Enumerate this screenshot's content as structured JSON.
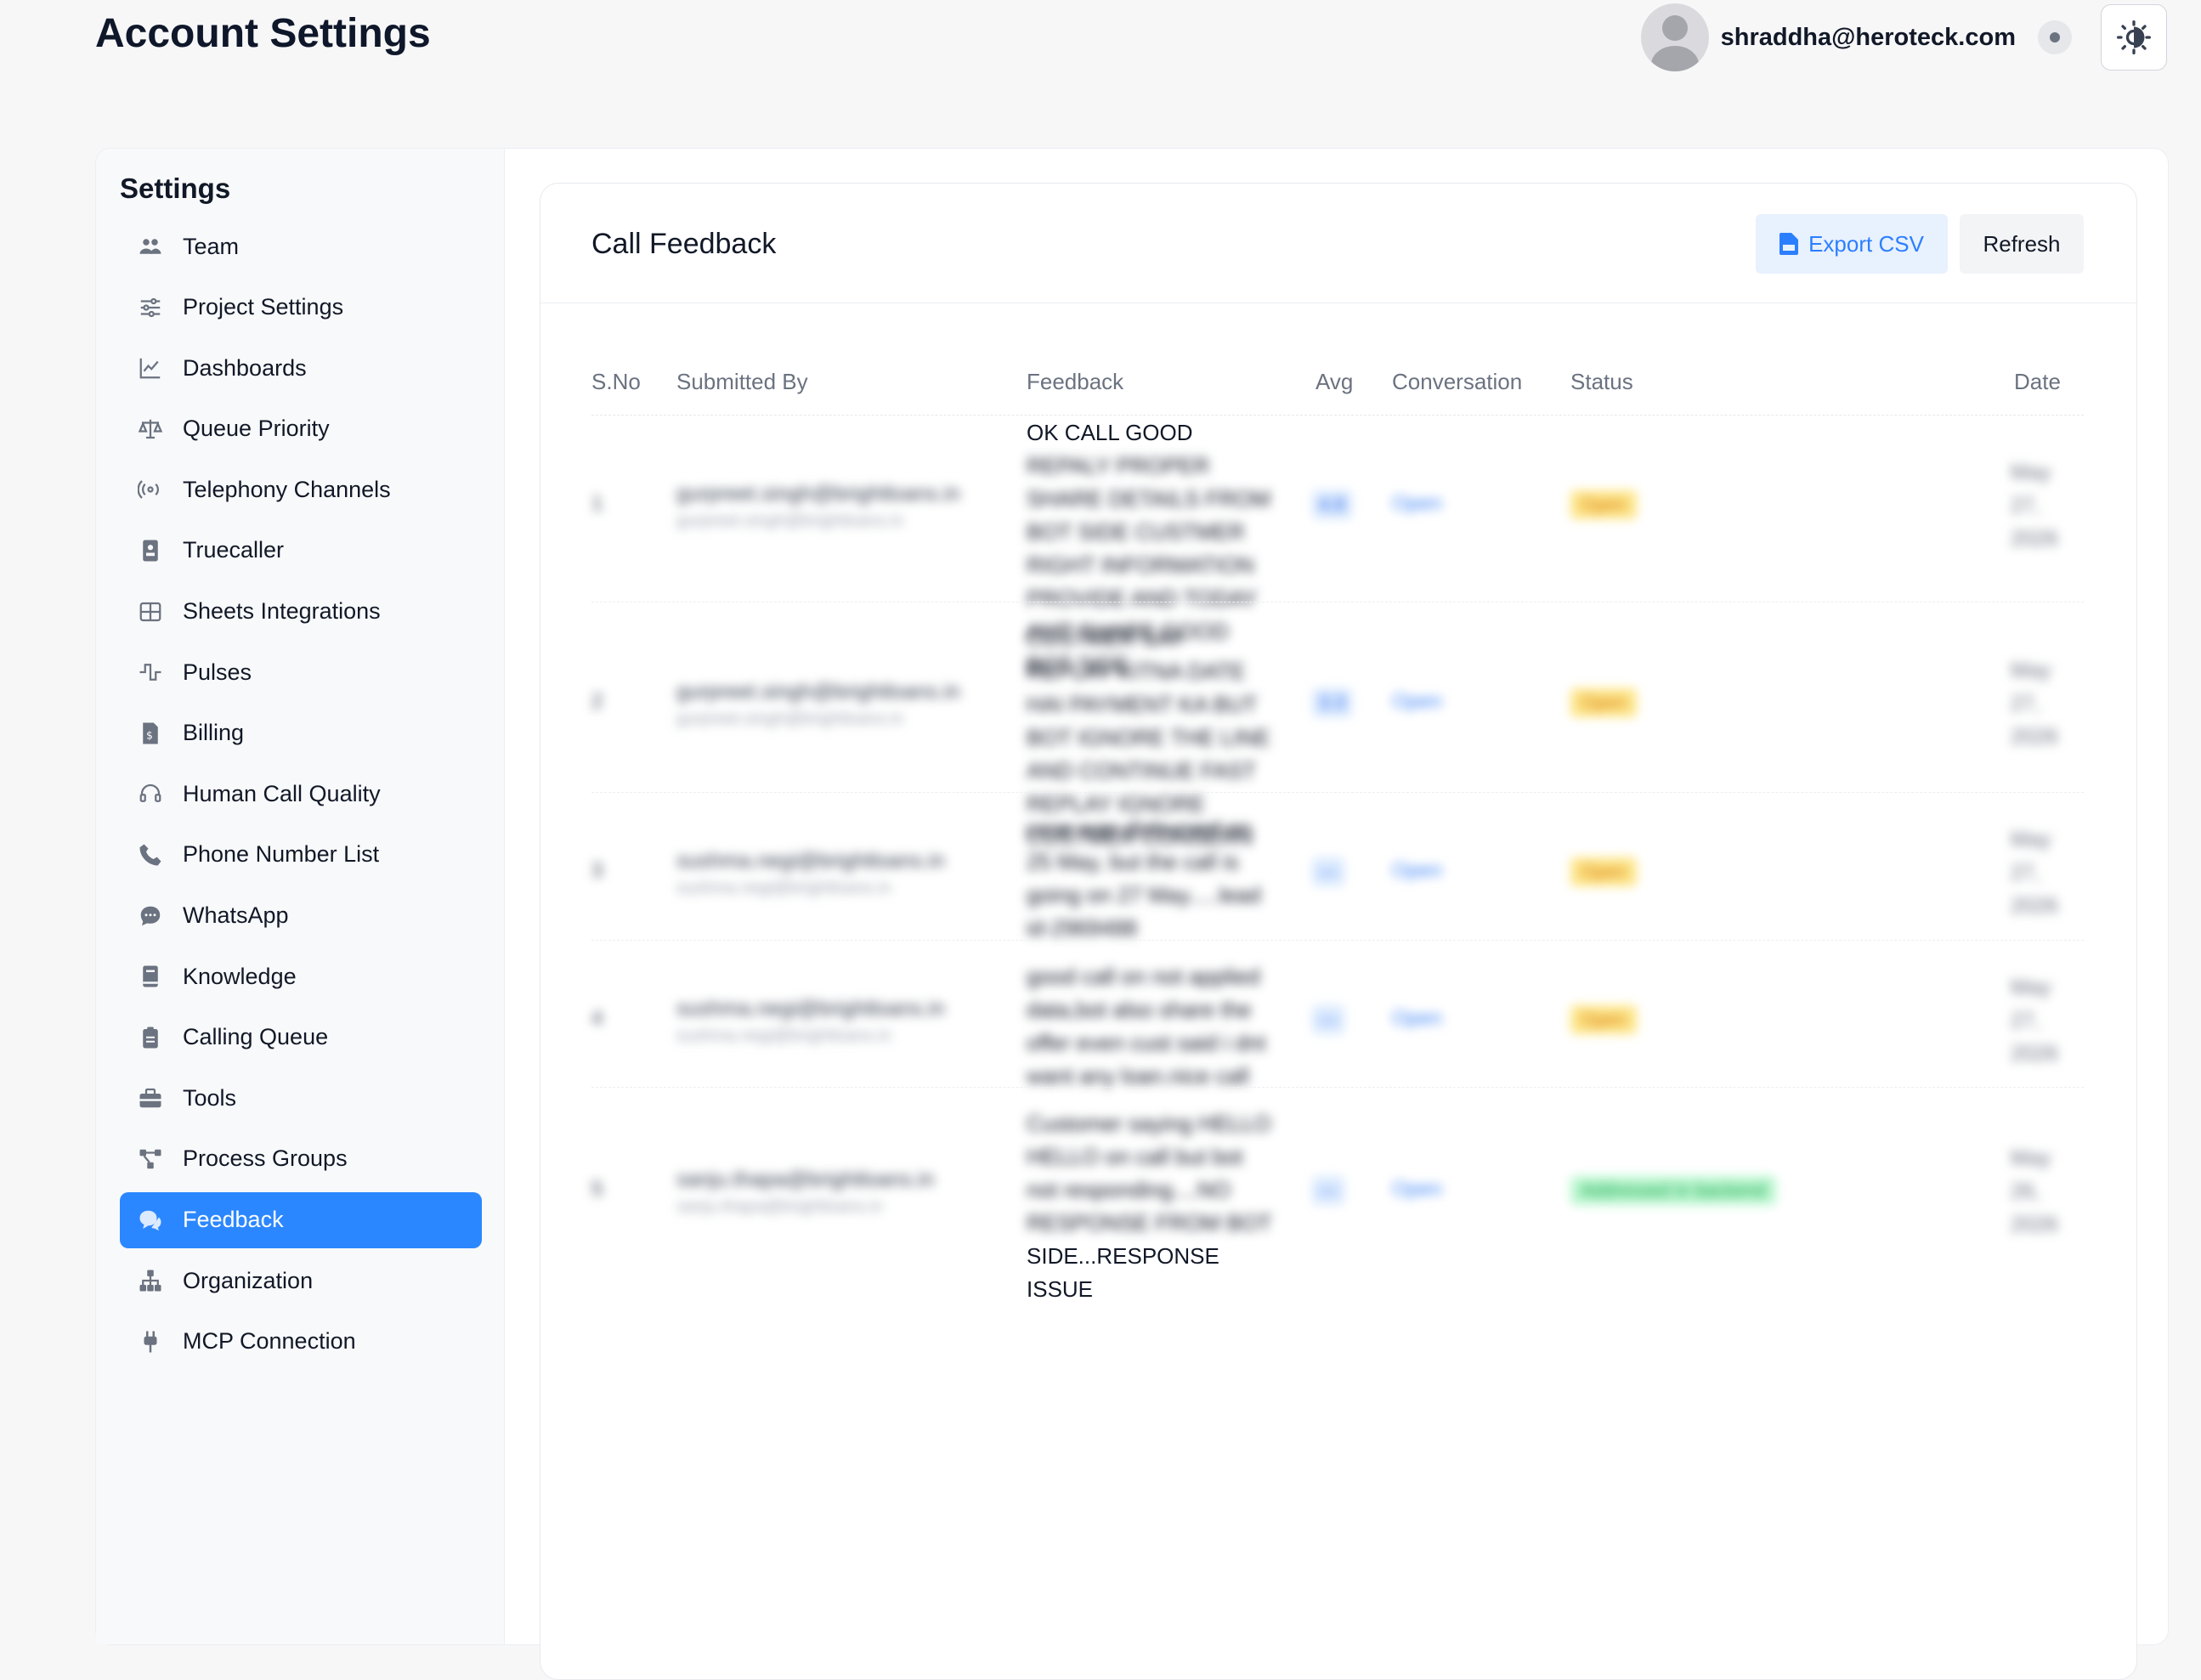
{
  "header": {
    "title": "Account Settings",
    "user_email": "shraddha@heroteck.com"
  },
  "sidebar": {
    "title": "Settings",
    "items": [
      {
        "label": "Team",
        "icon": "team-icon"
      },
      {
        "label": "Project Settings",
        "icon": "sliders-icon"
      },
      {
        "label": "Dashboards",
        "icon": "chart-line-icon"
      },
      {
        "label": "Queue Priority",
        "icon": "scale-icon"
      },
      {
        "label": "Telephony Channels",
        "icon": "broadcast-icon"
      },
      {
        "label": "Truecaller",
        "icon": "contact-card-icon"
      },
      {
        "label": "Sheets Integrations",
        "icon": "grid-icon"
      },
      {
        "label": "Pulses",
        "icon": "pulse-icon"
      },
      {
        "label": "Billing",
        "icon": "invoice-icon"
      },
      {
        "label": "Human Call Quality",
        "icon": "headset-icon"
      },
      {
        "label": "Phone Number List",
        "icon": "phone-icon"
      },
      {
        "label": "WhatsApp",
        "icon": "chat-bubble-icon"
      },
      {
        "label": "Knowledge",
        "icon": "book-icon"
      },
      {
        "label": "Calling Queue",
        "icon": "clipboard-icon"
      },
      {
        "label": "Tools",
        "icon": "toolbox-icon"
      },
      {
        "label": "Process Groups",
        "icon": "process-icon"
      },
      {
        "label": "Feedback",
        "icon": "feedback-icon",
        "active": true
      },
      {
        "label": "Organization",
        "icon": "org-chart-icon"
      },
      {
        "label": "MCP Connection",
        "icon": "plug-icon"
      }
    ]
  },
  "card": {
    "title": "Call Feedback",
    "export_label": "Export CSV",
    "refresh_label": "Refresh"
  },
  "table": {
    "columns": [
      "S.No",
      "Submitted By",
      "Feedback",
      "Avg",
      "Conversation",
      "Status",
      "Date"
    ],
    "rows": [
      {
        "sno": "1",
        "submitted_by": "gurpreet.singh@brightloans.in",
        "submitted_by_sub": "gurpreet.singh@brightloans.in",
        "feedback_first": "OK CALL GOOD",
        "feedback_rest": "REPALY PROPER SHARE DETAILS FROM BOT SIDE CUSTMER RIGHT INFORMATION PROVIDE AND TODAY AMT SHARE GOOD BOT SIDE",
        "avg": "4.8",
        "conversation": "Open",
        "status": "Open",
        "date": "May 27, 2026"
      },
      {
        "sno": "2",
        "submitted_by": "gurpreet.singh@brightloans.in",
        "submitted_by_sub": "gurpreet.singh@brightloans.in",
        "feedback_first": "",
        "feedback_rest": "CUSTMER SAY REPLAY KITNA DATE HAI PAYMENT KA BUT BOT IGNORE THE LINE AND CONTINUE FAST REPLAY IGNORE CUSTMER CONSERN",
        "avg": "3.3",
        "conversation": "Open",
        "status": "Open",
        "date": "May 27, 2026"
      },
      {
        "sno": "3",
        "submitted_by": "sushma.negi@brightloans.in",
        "submitted_by_sub": "sushma.negi@brightloans.in",
        "feedback_first": "",
        "feedback_rest": "case was disbursed on 25 May, but the call is going on 27 May.....lead id-2969488",
        "avg": "—",
        "conversation": "Open",
        "status": "Open",
        "date": "May 27, 2026"
      },
      {
        "sno": "4",
        "submitted_by": "sushma.negi@brightloans.in",
        "submitted_by_sub": "sushma.negi@brightloans.in",
        "feedback_first": "",
        "feedback_rest": "good call on not applied data,bot also share the offer even cust said i dnt want any loan.nice call",
        "avg": "—",
        "conversation": "Open",
        "status": "Open",
        "date": "May 27, 2026"
      },
      {
        "sno": "5",
        "submitted_by": "sanju.thapa@brightloans.in",
        "submitted_by_sub": "sanju.thapa@brightloans.in",
        "feedback_first": "",
        "feedback_rest": "Customer saying HELLO HELLO on call but bot not responding....NO RESPONSE FROM BOT",
        "feedback_last": "SIDE...RESPONSE ISSUE",
        "avg": "—",
        "conversation": "Open",
        "status": "Addressed in backend",
        "date": "May 26, 2026"
      }
    ]
  },
  "colors": {
    "accent": "#2b87ff",
    "status_open_bg": "#fde68a",
    "status_addressed_bg": "#bbf7d0",
    "avg_bg": "#dbeafe"
  }
}
